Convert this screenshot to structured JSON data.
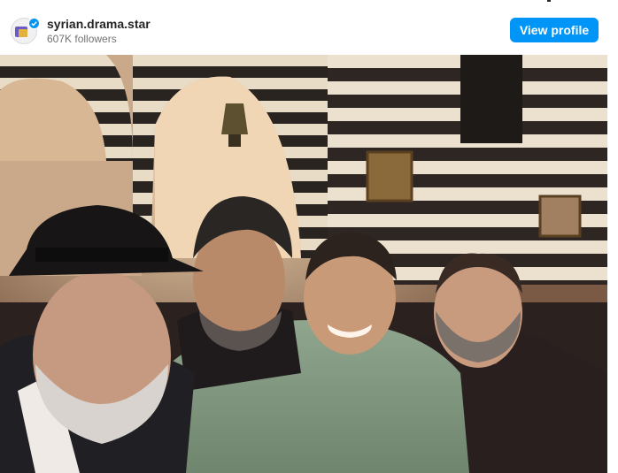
{
  "post": {
    "username": "syrian.drama.star",
    "followers": "607K followers",
    "view_profile_label": "View profile",
    "verified": true
  },
  "icons": {
    "avatar": "profile-avatar-icon",
    "verified": "verified-badge-icon"
  },
  "colors": {
    "primary_button": "#0095f6",
    "username_text": "#262626",
    "secondary_text": "#737373"
  },
  "photo": {
    "description_alt": ""
  }
}
